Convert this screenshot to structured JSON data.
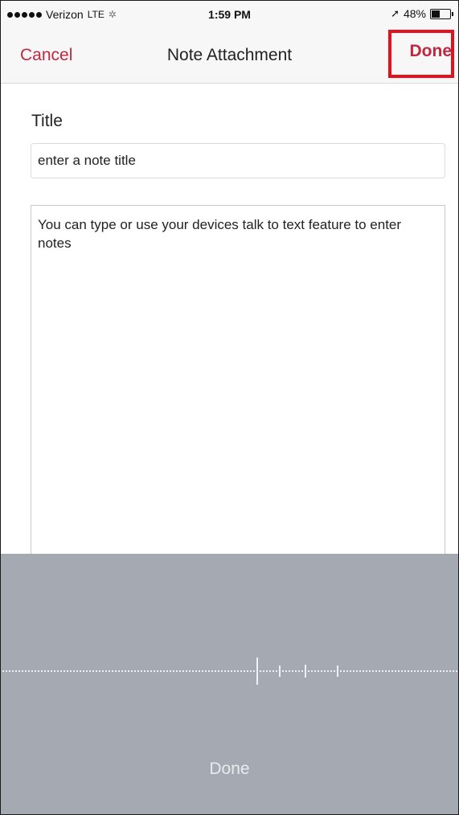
{
  "status_bar": {
    "carrier": "Verizon",
    "network": "LTE",
    "time": "1:59 PM",
    "battery": "48%",
    "battery_level": 0.48
  },
  "nav": {
    "cancel_label": "Cancel",
    "title": "Note Attachment",
    "done_label": "Done",
    "accent_color": "#c0283f",
    "highlight_color": "#e3101e"
  },
  "form": {
    "title_label": "Title",
    "title_placeholder": "enter a note title",
    "notes_value": "You can type or use your devices talk to text feature to enter notes"
  },
  "dictation": {
    "done_label": "Done",
    "panel_color": "#a4a9b2"
  }
}
